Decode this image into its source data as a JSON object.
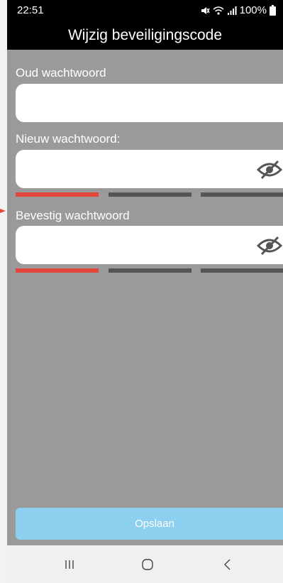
{
  "status_bar": {
    "time": "22:51",
    "battery": "100%",
    "icons": [
      "mute-icon",
      "wifi-icon",
      "signal-icon",
      "battery-icon"
    ]
  },
  "header": {
    "title": "Wijzig beveiligingscode"
  },
  "form": {
    "old_password": {
      "label": "Oud wachtwoord",
      "value": ""
    },
    "new_password": {
      "label": "Nieuw wachtwoord:",
      "value": "",
      "visibility_icon": "eye-slash-icon",
      "strength_level": 1,
      "strength_max": 3
    },
    "confirm_password": {
      "label": "Bevestig wachtwoord",
      "value": "",
      "visibility_icon": "eye-slash-icon",
      "strength_level": 1,
      "strength_max": 3
    }
  },
  "actions": {
    "save_label": "Opslaan"
  },
  "colors": {
    "background": "#9a9a9a",
    "header": "#000000",
    "strength_weak": "#e4453a",
    "strength_empty": "#555555",
    "save_button": "#8ccfee"
  },
  "nav": {
    "icons": [
      "recent-apps-icon",
      "home-icon",
      "back-icon"
    ]
  }
}
